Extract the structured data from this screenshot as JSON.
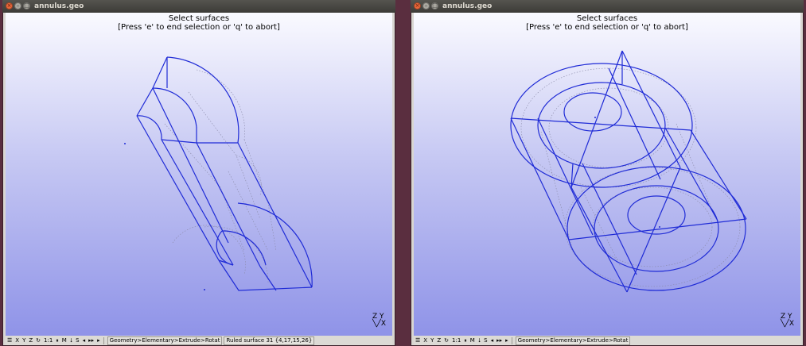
{
  "windows": [
    {
      "title": "annulus.geo",
      "message": {
        "line1": "Select surfaces",
        "line2": "[Press 'e' to end selection or 'q' to abort]"
      },
      "axes": {
        "top": "Z Y",
        "bottom": "╲╱X"
      },
      "status": {
        "buttons": [
          "☰",
          "X",
          "Y",
          "Z",
          "↻",
          "1:1",
          "⏸",
          "M",
          "⭣",
          "S",
          "◂",
          "▸▸",
          "▸"
        ],
        "breadcrumb": "Geometry>Elementary>Extrude>Rotat",
        "info": "Ruled surface 31 {4,17,15,26}"
      }
    },
    {
      "title": "annulus.geo",
      "message": {
        "line1": "Select surfaces",
        "line2": "[Press 'e' to end selection or 'q' to abort]"
      },
      "axes": {
        "top": "Z Y",
        "bottom": "╲╱X"
      },
      "status": {
        "buttons": [
          "☰",
          "X",
          "Y",
          "Z",
          "↻",
          "1:1",
          "⏸",
          "M",
          "⭣",
          "S",
          "◂",
          "▸▸",
          "▸"
        ],
        "breadcrumb": "Geometry>Elementary>Extrude>Rotat",
        "info": ""
      }
    }
  ],
  "colors": {
    "wire": "#1f2bd6",
    "dotted": "#8a8aa8",
    "accent": "#e9673b"
  },
  "icons": {
    "close": "close-icon",
    "minimize": "minimize-icon",
    "maximize": "maximize-icon"
  }
}
